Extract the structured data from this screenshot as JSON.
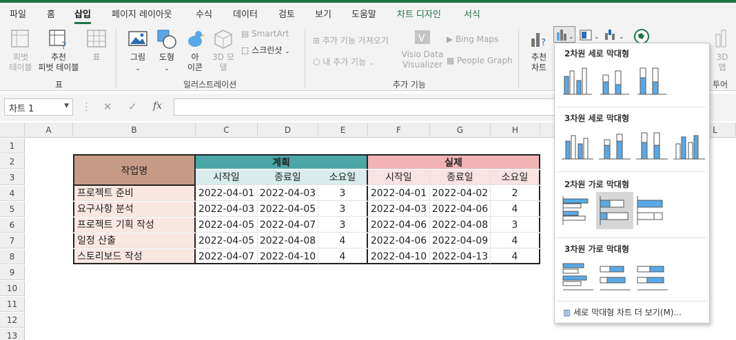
{
  "menu": {
    "tabs": [
      "파일",
      "홈",
      "삽입",
      "페이지 레이아웃",
      "수식",
      "데이터",
      "검토",
      "보기",
      "도움말",
      "차트 디자인",
      "서식"
    ]
  },
  "ribbon": {
    "pivot_table": "피벗\n테이블",
    "recommended_pivot": "추천\n피벗 테이블",
    "table": "표",
    "group_table": "표",
    "picture": "그림",
    "shapes": "도형",
    "icons": "아\n이콘",
    "models_3d": "3D 모\n델",
    "smartart": "SmartArt",
    "screenshot": "스크린샷",
    "group_illustrations": "일러스트레이션",
    "get_addins": "추가 기능 가져오기",
    "my_addins": "내 추가 기능",
    "visio": "Visio Data\nVisualizer",
    "bing_maps": "Bing Maps",
    "people_graph": "People Graph",
    "group_addins": "추가 기능",
    "recommended_charts": "추천\n차트",
    "map_3d": "3D\n맵",
    "group_tours": "투어"
  },
  "formula_bar": {
    "name_box": "차트 1",
    "cancel_icon": "✕",
    "enter_icon": "✓",
    "fx": "fx",
    "value": ""
  },
  "grid": {
    "columns": [
      "A",
      "B",
      "C",
      "D",
      "E",
      "F",
      "G",
      "H",
      "L"
    ],
    "rows": [
      "1",
      "2",
      "3",
      "4",
      "5",
      "6",
      "7",
      "8",
      "9",
      "10",
      "11",
      "12",
      "13"
    ],
    "header_task": "작업명",
    "header_plan": "계획",
    "header_actual": "실제",
    "sub_start": "시작일",
    "sub_end": "종료일",
    "sub_days": "소요일",
    "tasks": [
      {
        "name": "프로젝트 준비",
        "plan_start": "2022-04-01",
        "plan_end": "2022-04-03",
        "plan_days": "3",
        "act_start": "2022-04-01",
        "act_end": "2022-04-02",
        "act_days": "2"
      },
      {
        "name": "요구사항 분석",
        "plan_start": "2022-04-03",
        "plan_end": "2022-04-05",
        "plan_days": "3",
        "act_start": "2022-04-03",
        "act_end": "2022-04-06",
        "act_days": "4"
      },
      {
        "name": "프로젝트 기획 작성",
        "plan_start": "2022-04-05",
        "plan_end": "2022-04-07",
        "plan_days": "3",
        "act_start": "2022-04-06",
        "act_end": "2022-04-08",
        "act_days": "3"
      },
      {
        "name": "일정 산출",
        "plan_start": "2022-04-05",
        "plan_end": "2022-04-08",
        "plan_days": "4",
        "act_start": "2022-04-06",
        "act_end": "2022-04-09",
        "act_days": "4"
      },
      {
        "name": "스토리보드 작성",
        "plan_start": "2022-04-07",
        "plan_end": "2022-04-10",
        "plan_days": "4",
        "act_start": "2022-04-10",
        "act_end": "2022-04-13",
        "act_days": "4"
      }
    ]
  },
  "chart_menu": {
    "section_2d_column": "2차원 세로 막대형",
    "section_3d_column": "3차원 세로 막대형",
    "section_2d_bar": "2차원 가로 막대형",
    "section_3d_bar": "3차원 가로 막대형",
    "more_charts": "세로 막대형 차트 더 보기(M)..."
  },
  "colors": {
    "accent_green": "#217346",
    "plan_header": "#4ba6a6",
    "actual_header": "#f2b3b6",
    "task_header": "#c79a86",
    "chart_blue": "#5aa9e6"
  }
}
